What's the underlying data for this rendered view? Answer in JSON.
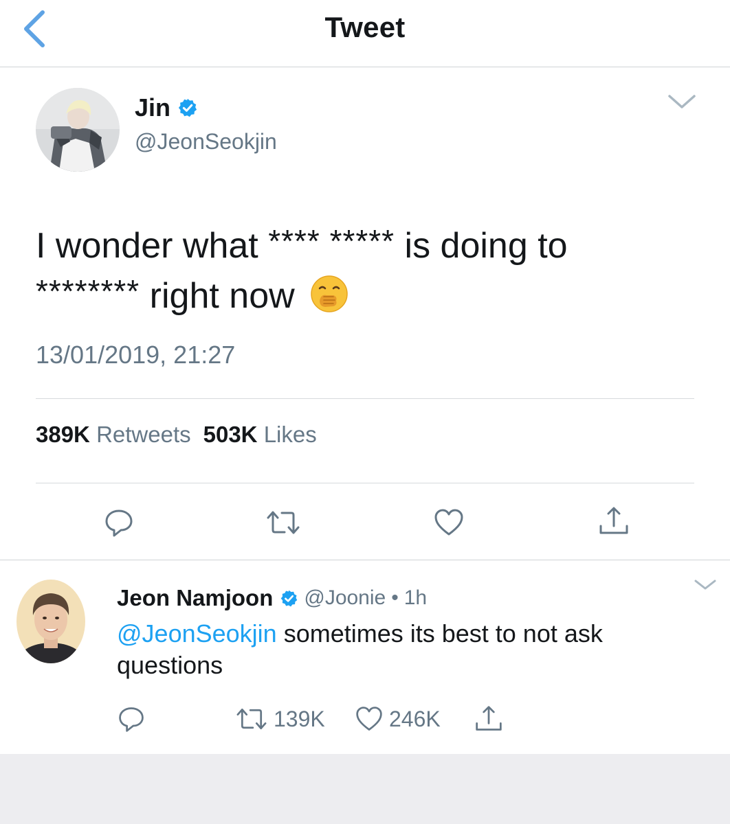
{
  "header": {
    "title": "Tweet",
    "back_icon": "chevron-left-icon"
  },
  "tweet": {
    "display_name": "Jin",
    "handle": "@JeonSeokjin",
    "verified": true,
    "text_line1_a": "I wonder what ",
    "text_line1_stars": "**** *****",
    "text_line1_b": " is doing to",
    "text_line2_stars": "********",
    "text_line2_b": " right now",
    "emoji": "face-with-hand-over-mouth",
    "timestamp": "13/01/2019, 21:27",
    "retweets_count": "389K",
    "retweets_label": "Retweets",
    "likes_count": "503K",
    "likes_label": "Likes",
    "actions": [
      "reply-icon",
      "retweet-icon",
      "like-icon",
      "share-icon"
    ]
  },
  "reply": {
    "display_name": "Jeon Namjoon",
    "handle": "@Joonie",
    "separator": "•",
    "time": "1h",
    "verified": true,
    "mention": "@JeonSeokjin",
    "text": " sometimes its best to not ask questions",
    "retweets": "139K",
    "likes": "246K"
  },
  "colors": {
    "accent": "#1da1f2",
    "secondary_text": "#657786",
    "primary_text": "#14171a",
    "divider": "#cfd3d6",
    "back_arrow": "#6aa6e0"
  }
}
